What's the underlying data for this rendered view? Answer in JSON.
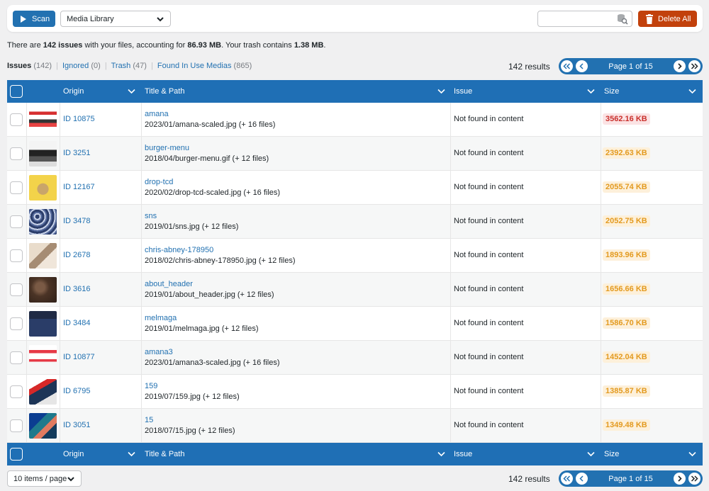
{
  "toolbar": {
    "scan_label": "Scan",
    "source_select": "Media Library",
    "search_placeholder": "",
    "delete_all_label": "Delete All"
  },
  "summary": {
    "prefix": "There are ",
    "issues_count": "142 issues",
    "middle": " with your files, accounting for ",
    "size": "86.93 MB",
    "trash_text": ". Your trash contains ",
    "trash_size": "1.38 MB",
    "suffix": "."
  },
  "filters": [
    {
      "label": "Issues",
      "count": "(142)"
    },
    {
      "label": "Ignored",
      "count": "(0)"
    },
    {
      "label": "Trash",
      "count": "(47)"
    },
    {
      "label": "Found In Use Medias",
      "count": "(865)"
    }
  ],
  "pagination": {
    "results": "142 results",
    "page_label": "Page 1 of 15",
    "per_page": "10 items / page"
  },
  "columns": {
    "origin": "Origin",
    "title_path": "Title & Path",
    "issue": "Issue",
    "size": "Size"
  },
  "rows": [
    {
      "origin": "ID 10875",
      "title": "amana",
      "path": "2023/01/amana-scaled.jpg (+ 16 files)",
      "issue": "Not found in content",
      "size": "3562.16 KB",
      "level": "red",
      "thumb": "mockup-red"
    },
    {
      "origin": "ID 3251",
      "title": "burger-menu",
      "path": "2018/04/burger-menu.gif (+ 12 files)",
      "issue": "Not found in content",
      "size": "2392.63 KB",
      "level": "orange",
      "thumb": "website-dark"
    },
    {
      "origin": "ID 12167",
      "title": "drop-tcd",
      "path": "2020/02/drop-tcd-scaled.jpg (+ 16 files)",
      "issue": "Not found in content",
      "size": "2055.74 KB",
      "level": "orange",
      "thumb": "yellow-bread"
    },
    {
      "origin": "ID 3478",
      "title": "sns",
      "path": "2019/01/sns.jpg (+ 12 files)",
      "issue": "Not found in content",
      "size": "2052.75 KB",
      "level": "orange",
      "thumb": "blue-pattern"
    },
    {
      "origin": "ID 2678",
      "title": "chris-abney-178950",
      "path": "2018/02/chris-abney-178950.jpg (+ 12 files)",
      "issue": "Not found in content",
      "size": "1893.96 KB",
      "level": "orange",
      "thumb": "hands-beige"
    },
    {
      "origin": "ID 3616",
      "title": "about_header",
      "path": "2019/01/about_header.jpg (+ 12 files)",
      "issue": "Not found in content",
      "size": "1656.66 KB",
      "level": "orange",
      "thumb": "brown-texture"
    },
    {
      "origin": "ID 3484",
      "title": "melmaga",
      "path": "2019/01/melmaga.jpg (+ 12 files)",
      "issue": "Not found in content",
      "size": "1586.70 KB",
      "level": "orange",
      "thumb": "navy-envelope"
    },
    {
      "origin": "ID 10877",
      "title": "amana3",
      "path": "2023/01/amana3-scaled.jpg (+ 16 files)",
      "issue": "Not found in content",
      "size": "1452.04 KB",
      "level": "orange",
      "thumb": "mockup-white"
    },
    {
      "origin": "ID 6795",
      "title": "159",
      "path": "2019/07/159.jpg (+ 12 files)",
      "issue": "Not found in content",
      "size": "1385.87 KB",
      "level": "orange",
      "thumb": "red-blue-diag"
    },
    {
      "origin": "ID 3051",
      "title": "15",
      "path": "2018/07/15.jpg (+ 12 files)",
      "issue": "Not found in content",
      "size": "1349.48 KB",
      "level": "orange",
      "thumb": "ocean-coral"
    }
  ],
  "colors": {
    "accent": "#2271b1",
    "header_blue": "#1f6fb5",
    "danger": "#c2410c",
    "size_red": "#c9302c",
    "size_orange": "#e39a1f"
  }
}
